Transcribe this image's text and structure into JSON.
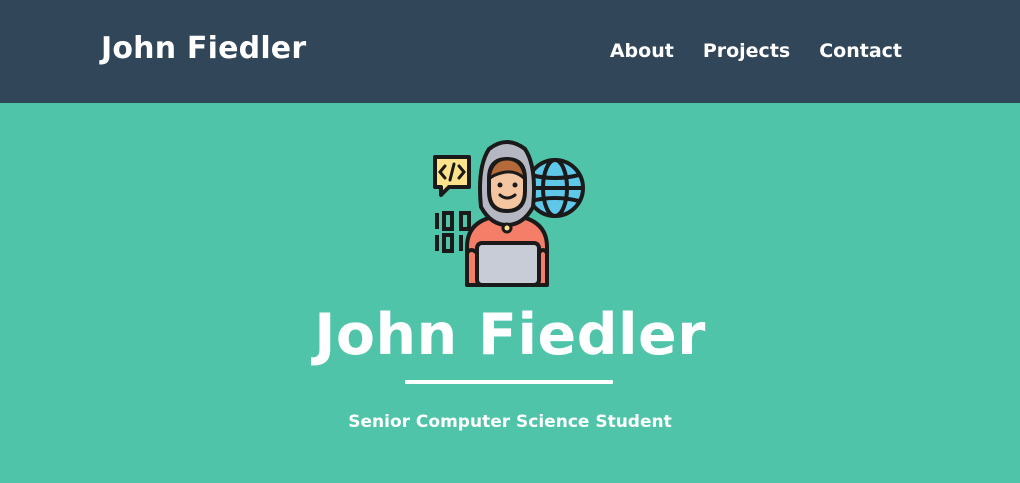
{
  "navbar": {
    "brand": "John Fiedler",
    "links": [
      {
        "label": "About"
      },
      {
        "label": "Projects"
      },
      {
        "label": "Contact"
      }
    ]
  },
  "masthead": {
    "avatar_icon": "developer-avatar-icon",
    "name": "John Fiedler",
    "subtitle": "Senior Computer Science Student"
  },
  "colors": {
    "navbar_bg": "#314659",
    "masthead_bg": "#4fc4a9",
    "text": "#ffffff"
  }
}
